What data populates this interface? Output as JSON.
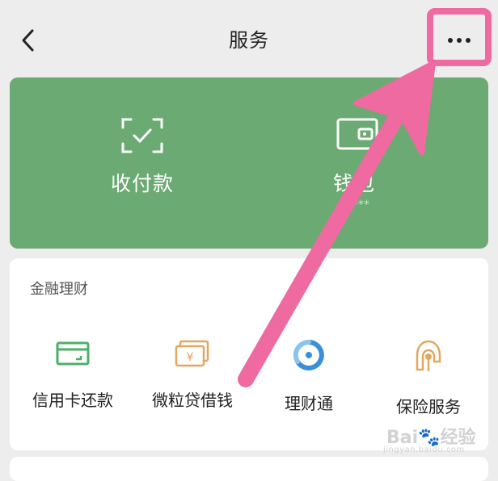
{
  "header": {
    "title": "服务"
  },
  "pay_card": {
    "items": [
      {
        "label": "收付款",
        "icon": "scan-icon"
      },
      {
        "label": "钱包",
        "sublabel": "¥***",
        "icon": "wallet-icon"
      }
    ]
  },
  "finance": {
    "section_title": "金融理财",
    "items": [
      {
        "label": "信用卡还款",
        "icon": "credit-card-icon"
      },
      {
        "label": "微粒贷借钱",
        "icon": "cash-icon"
      },
      {
        "label": "理财通",
        "icon": "wealth-icon"
      },
      {
        "label": "保险服务",
        "icon": "insurance-icon"
      }
    ]
  },
  "colors": {
    "green": "#6baa72",
    "highlight": "#ef6aa0",
    "bg": "#ededed"
  }
}
